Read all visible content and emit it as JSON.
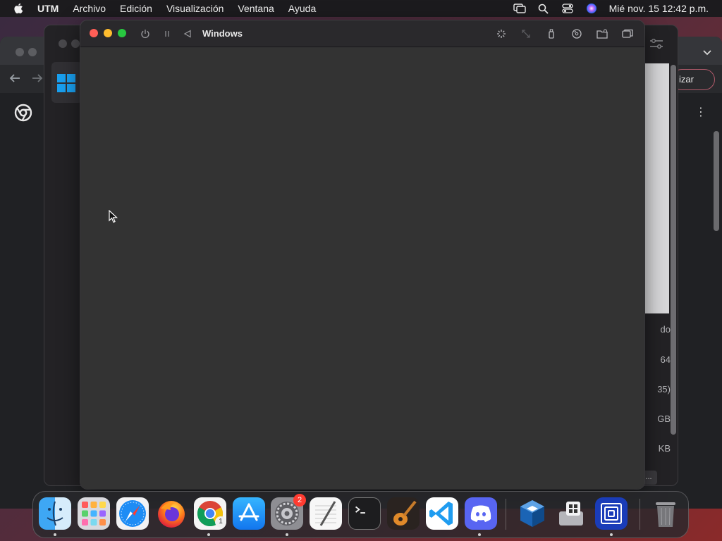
{
  "menubar": {
    "app_name": "UTM",
    "items": [
      "Archivo",
      "Edición",
      "Visualización",
      "Ventana",
      "Ayuda"
    ],
    "clock": "Mié nov. 15  12:42 p.m."
  },
  "chrome_window": {
    "right_button_label": "izar",
    "kebab": "⋮"
  },
  "utm_window": {
    "info_labels": [
      "do",
      "64",
      "35)",
      "GB",
      "KB"
    ],
    "more_label": "..."
  },
  "vm_window": {
    "title": "Windows"
  },
  "dock": {
    "apps": [
      {
        "name": "Finder",
        "running": true
      },
      {
        "name": "Launchpad",
        "running": false
      },
      {
        "name": "Safari",
        "running": false
      },
      {
        "name": "Firefox",
        "running": false
      },
      {
        "name": "Google Chrome",
        "running": true,
        "sub_badge": "1"
      },
      {
        "name": "App Store",
        "running": false
      },
      {
        "name": "System Settings",
        "running": true,
        "badge": "2"
      },
      {
        "name": "TextEdit",
        "running": false
      },
      {
        "name": "Terminal",
        "running": false
      },
      {
        "name": "GarageBand",
        "running": false
      },
      {
        "name": "Visual Studio Code",
        "running": false
      },
      {
        "name": "Discord",
        "running": true
      },
      {
        "name": "VirtualBox",
        "running": false
      },
      {
        "name": "Boot Camp Assistant",
        "running": false
      },
      {
        "name": "UTM",
        "running": true
      },
      {
        "name": "Trash",
        "running": false
      }
    ]
  }
}
